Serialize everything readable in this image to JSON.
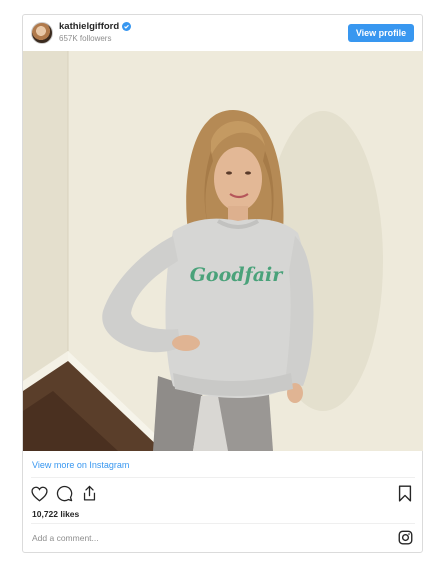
{
  "profile": {
    "username": "kathielgifford",
    "followers": "657K followers",
    "view_profile_label": "View profile"
  },
  "post": {
    "sweatshirt_text": "Goodfair",
    "view_more_label": "View more on Instagram",
    "likes": "10,722 likes"
  },
  "comment": {
    "placeholder": "Add a comment..."
  },
  "icons": {
    "like": "heart-icon",
    "comment": "comment-icon",
    "share": "share-icon",
    "save": "bookmark-icon",
    "brand": "instagram-icon",
    "verified": "verified-badge-icon"
  },
  "colors": {
    "accent": "#3897f0",
    "wall": "#eeeadb",
    "sweatshirt": "#d6d6d4",
    "logo_text": "#4aa27a"
  }
}
